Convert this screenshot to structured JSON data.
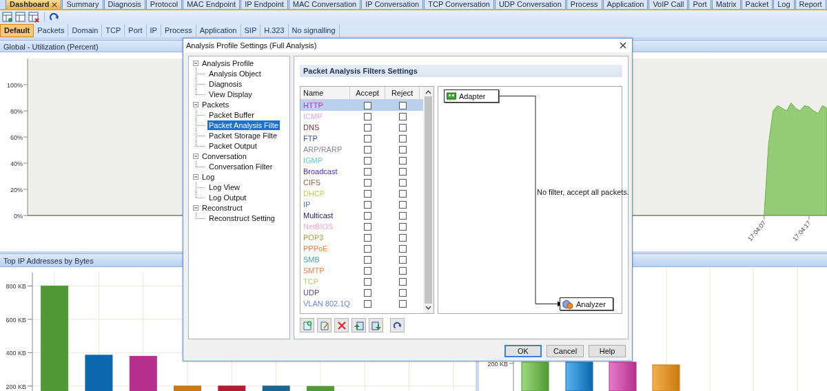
{
  "main_tabs": [
    {
      "label": "Dashboard",
      "selected": true,
      "closable": true
    },
    {
      "label": "Summary",
      "selected": false,
      "closable": false
    },
    {
      "label": "Diagnosis",
      "selected": false,
      "closable": false
    },
    {
      "label": "Protocol",
      "selected": false,
      "closable": false
    },
    {
      "label": "MAC Endpoint",
      "selected": false,
      "closable": false
    },
    {
      "label": "IP Endpoint",
      "selected": false,
      "closable": false
    },
    {
      "label": "MAC Conversation",
      "selected": false,
      "closable": false
    },
    {
      "label": "IP Conversation",
      "selected": false,
      "closable": false
    },
    {
      "label": "TCP Conversation",
      "selected": false,
      "closable": false
    },
    {
      "label": "UDP Conversation",
      "selected": false,
      "closable": false
    },
    {
      "label": "Process",
      "selected": false,
      "closable": false
    },
    {
      "label": "Application",
      "selected": false,
      "closable": false
    },
    {
      "label": "VoIP Call",
      "selected": false,
      "closable": false
    },
    {
      "label": "Port",
      "selected": false,
      "closable": false
    },
    {
      "label": "Matrix",
      "selected": false,
      "closable": false
    },
    {
      "label": "Packet",
      "selected": false,
      "closable": false
    },
    {
      "label": "Log",
      "selected": false,
      "closable": false
    },
    {
      "label": "Report",
      "selected": false,
      "closable": false
    }
  ],
  "view_tabs": [
    {
      "label": "Default",
      "selected": true
    },
    {
      "label": "Packets",
      "selected": false
    },
    {
      "label": "Domain",
      "selected": false
    },
    {
      "label": "TCP",
      "selected": false
    },
    {
      "label": "Port",
      "selected": false
    },
    {
      "label": "IP",
      "selected": false
    },
    {
      "label": "Process",
      "selected": false
    },
    {
      "label": "Application",
      "selected": false
    },
    {
      "label": "SIP",
      "selected": false
    },
    {
      "label": "H.323",
      "selected": false
    },
    {
      "label": "No signalling",
      "selected": false
    }
  ],
  "utilization_panel": {
    "title": "Global - Utilization (Percent)",
    "chart_data": {
      "type": "area",
      "x": [
        61283,
        61446,
        61447,
        61448,
        61449,
        61450,
        61451,
        61452,
        61453,
        61454,
        61455,
        61456,
        61457,
        61458,
        61459,
        61460,
        61461
      ],
      "values": [
        0,
        0,
        0,
        55,
        80,
        84,
        82,
        80,
        86,
        82,
        80,
        84,
        83,
        80,
        78,
        84,
        82
      ],
      "xlim": [
        61283,
        61461
      ],
      "ylim": [
        0,
        120
      ],
      "yticks": [
        {
          "value": 0,
          "label": "0%"
        },
        {
          "value": 20,
          "label": "20%"
        },
        {
          "value": 40,
          "label": "40%"
        },
        {
          "value": 60,
          "label": "60%"
        },
        {
          "value": 80,
          "label": "80%"
        },
        {
          "value": 100,
          "label": "100%"
        }
      ],
      "xticks": [
        {
          "value": 61447,
          "label": "17:04:07"
        },
        {
          "value": 61457,
          "label": "17:04:17"
        }
      ]
    }
  },
  "bytes_panel": {
    "title": "Top IP Addresses by Bytes",
    "chart_data": {
      "type": "bar",
      "values": [
        800,
        385,
        378,
        200,
        200,
        200,
        198,
        null,
        null,
        null
      ],
      "ylim": [
        170,
        880
      ],
      "grid": true,
      "yticks": [
        {
          "value": 200,
          "label": "200 KB"
        },
        {
          "value": 400,
          "label": "400 KB"
        },
        {
          "value": 600,
          "label": "600 KB"
        },
        {
          "value": 800,
          "label": "800 KB"
        }
      ]
    }
  },
  "second_bytes_panel": {
    "y_axis_labels": [
      "200 KB"
    ]
  },
  "dialog": {
    "title": "Analysis Profile Settings (Full Analysis)",
    "tree": [
      {
        "label": "Analysis Profile",
        "expanded": true,
        "selected": false,
        "children": [
          {
            "label": "Analysis Object",
            "selected": false
          },
          {
            "label": "Diagnosis",
            "selected": false
          },
          {
            "label": "View Display",
            "selected": false
          }
        ]
      },
      {
        "label": "Packets",
        "expanded": true,
        "selected": false,
        "children": [
          {
            "label": "Packet Buffer",
            "selected": false
          },
          {
            "label": "Packet Analysis Filte",
            "selected": true
          },
          {
            "label": "Packet Storage Filte",
            "selected": false
          },
          {
            "label": "Packet Output",
            "selected": false
          }
        ]
      },
      {
        "label": "Conversation",
        "expanded": true,
        "selected": false,
        "children": [
          {
            "label": "Conversation Filter",
            "selected": false
          }
        ]
      },
      {
        "label": "Log",
        "expanded": true,
        "selected": false,
        "children": [
          {
            "label": "Log View",
            "selected": false
          },
          {
            "label": "Log Output",
            "selected": false
          }
        ]
      },
      {
        "label": "Reconstruct",
        "expanded": true,
        "selected": false,
        "children": [
          {
            "label": "Reconstruct Setting",
            "selected": false
          }
        ]
      }
    ],
    "section_title": "Packet Analysis Filters Settings",
    "filter_columns": [
      "Name",
      "Accept",
      "Reject"
    ],
    "filters": [
      {
        "name": "HTTP",
        "color": "#d024d0",
        "selected": true,
        "accept": false,
        "reject": false
      },
      {
        "name": "ICMP",
        "color": "#e2a6ea",
        "selected": false,
        "accept": false,
        "reject": false
      },
      {
        "name": "DNS",
        "color": "#a02834",
        "selected": false,
        "accept": false,
        "reject": false
      },
      {
        "name": "FTP",
        "color": "#34509c",
        "selected": false,
        "accept": false,
        "reject": false
      },
      {
        "name": "ARP/RARP",
        "color": "#8484a4",
        "selected": false,
        "accept": false,
        "reject": false
      },
      {
        "name": "IGMP",
        "color": "#5ccfd0",
        "selected": false,
        "accept": false,
        "reject": false
      },
      {
        "name": "Broadcast",
        "color": "#4a24dc",
        "selected": false,
        "accept": false,
        "reject": false
      },
      {
        "name": "CIFS",
        "color": "#a0603a",
        "selected": false,
        "accept": false,
        "reject": false
      },
      {
        "name": "DHCP",
        "color": "#c4d040",
        "selected": false,
        "accept": false,
        "reject": false
      },
      {
        "name": "IP",
        "color": "#5c70d4",
        "selected": false,
        "accept": false,
        "reject": false
      },
      {
        "name": "Multicast",
        "color": "#24226c",
        "selected": false,
        "accept": false,
        "reject": false
      },
      {
        "name": "NetBIOS",
        "color": "#f2a2c8",
        "selected": false,
        "accept": false,
        "reject": false
      },
      {
        "name": "POP3",
        "color": "#a4a046",
        "selected": false,
        "accept": false,
        "reject": false
      },
      {
        "name": "PPPoE",
        "color": "#f07a3c",
        "selected": false,
        "accept": false,
        "reject": false
      },
      {
        "name": "SMB",
        "color": "#40a2a4",
        "selected": false,
        "accept": false,
        "reject": false
      },
      {
        "name": "SMTP",
        "color": "#f08040",
        "selected": false,
        "accept": false,
        "reject": false
      },
      {
        "name": "TCP",
        "color": "#b4d064",
        "selected": false,
        "accept": false,
        "reject": false
      },
      {
        "name": "UDP",
        "color": "#544684",
        "selected": false,
        "accept": false,
        "reject": false
      },
      {
        "name": "VLAN 802.1Q",
        "color": "#6a84e0",
        "selected": false,
        "accept": false,
        "reject": false
      }
    ],
    "diagram": {
      "nodes": [
        {
          "kind": "adapter",
          "label": "Adapter"
        },
        {
          "kind": "analyzer",
          "label": "Analyzer"
        }
      ],
      "message": "No filter, accept all packets."
    },
    "buttons": [
      {
        "label": "OK",
        "default": true
      },
      {
        "label": "Cancel",
        "default": false
      },
      {
        "label": "Help",
        "default": false
      }
    ]
  }
}
